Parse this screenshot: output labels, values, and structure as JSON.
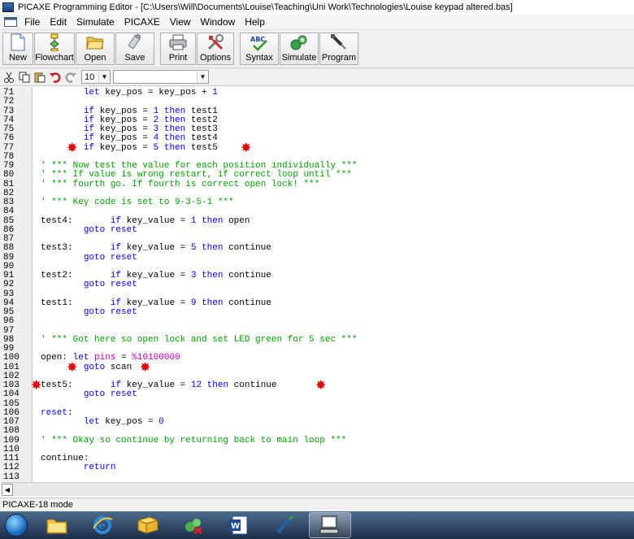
{
  "window": {
    "title": "PICAXE Programming Editor - [C:\\Users\\Will\\Documents\\Louise\\Teaching\\Uni Work\\Technologies\\Louise keypad altered.bas]"
  },
  "menu": [
    "File",
    "Edit",
    "Simulate",
    "PICAXE",
    "View",
    "Window",
    "Help"
  ],
  "toolbar": {
    "new": "New",
    "flowchart": "Flowchart",
    "open": "Open",
    "save": "Save",
    "print": "Print",
    "options": "Options",
    "syntax": "Syntax",
    "simulate": "Simulate",
    "program": "Program"
  },
  "toolbar2": {
    "font_size": "10",
    "combo_value": ""
  },
  "editor": {
    "lines": [
      {
        "n": "71",
        "t": [
          [
            "        ",
            ""
          ],
          [
            "let",
            "kw"
          ],
          [
            " key_pos = key_pos + ",
            ""
          ],
          [
            "1",
            "kw"
          ]
        ]
      },
      {
        "n": "72",
        "t": []
      },
      {
        "n": "73",
        "t": [
          [
            "        ",
            ""
          ],
          [
            "if",
            "kw"
          ],
          [
            " key_pos = ",
            ""
          ],
          [
            "1",
            "kw"
          ],
          [
            " ",
            ""
          ],
          [
            "then",
            "kw"
          ],
          [
            " test1",
            ""
          ]
        ]
      },
      {
        "n": "74",
        "t": [
          [
            "        ",
            ""
          ],
          [
            "if",
            "kw"
          ],
          [
            " key_pos = ",
            ""
          ],
          [
            "2",
            "kw"
          ],
          [
            " ",
            ""
          ],
          [
            "then",
            "kw"
          ],
          [
            " test2",
            ""
          ]
        ]
      },
      {
        "n": "75",
        "t": [
          [
            "        ",
            ""
          ],
          [
            "if",
            "kw"
          ],
          [
            " key_pos = ",
            ""
          ],
          [
            "3",
            "kw"
          ],
          [
            " ",
            ""
          ],
          [
            "then",
            "kw"
          ],
          [
            " test3",
            ""
          ]
        ]
      },
      {
        "n": "76",
        "t": [
          [
            "        ",
            ""
          ],
          [
            "if",
            "kw"
          ],
          [
            " key_pos = ",
            ""
          ],
          [
            "4",
            "kw"
          ],
          [
            " ",
            ""
          ],
          [
            "then",
            "kw"
          ],
          [
            " test4",
            ""
          ]
        ]
      },
      {
        "n": "77",
        "t": [
          [
            "        ",
            ""
          ],
          [
            "if",
            "kw"
          ],
          [
            " key_pos = ",
            ""
          ],
          [
            "5",
            "kw"
          ],
          [
            " ",
            ""
          ],
          [
            "then",
            "kw"
          ],
          [
            " test5",
            ""
          ]
        ]
      },
      {
        "n": "78",
        "t": []
      },
      {
        "n": "79",
        "t": [
          [
            "' *** Now test the value for each position individually ***",
            "cm"
          ]
        ]
      },
      {
        "n": "80",
        "t": [
          [
            "' *** If value is wrong restart, if correct loop until ***",
            "cm"
          ]
        ]
      },
      {
        "n": "81",
        "t": [
          [
            "' *** fourth go. If fourth is correct open lock! ***",
            "cm"
          ]
        ]
      },
      {
        "n": "82",
        "t": []
      },
      {
        "n": "83",
        "t": [
          [
            "' *** Key code is set to 9-3-5-1 ***",
            "cm"
          ]
        ]
      },
      {
        "n": "84",
        "t": []
      },
      {
        "n": "85",
        "t": [
          [
            "test4:",
            ""
          ],
          [
            "       ",
            ""
          ],
          [
            "if",
            "kw"
          ],
          [
            " key_value = ",
            ""
          ],
          [
            "1",
            "kw"
          ],
          [
            " ",
            ""
          ],
          [
            "then",
            "kw"
          ],
          [
            " open",
            ""
          ]
        ]
      },
      {
        "n": "86",
        "t": [
          [
            "        ",
            ""
          ],
          [
            "goto",
            "kw"
          ],
          [
            " ",
            ""
          ],
          [
            "reset",
            "kw"
          ]
        ]
      },
      {
        "n": "87",
        "t": []
      },
      {
        "n": "88",
        "t": [
          [
            "test3:",
            ""
          ],
          [
            "       ",
            ""
          ],
          [
            "if",
            "kw"
          ],
          [
            " key_value = ",
            ""
          ],
          [
            "5",
            "kw"
          ],
          [
            " ",
            ""
          ],
          [
            "then",
            "kw"
          ],
          [
            " continue",
            ""
          ]
        ]
      },
      {
        "n": "89",
        "t": [
          [
            "        ",
            ""
          ],
          [
            "goto",
            "kw"
          ],
          [
            " ",
            ""
          ],
          [
            "reset",
            "kw"
          ]
        ]
      },
      {
        "n": "90",
        "t": []
      },
      {
        "n": "91",
        "t": [
          [
            "test2:",
            ""
          ],
          [
            "       ",
            ""
          ],
          [
            "if",
            "kw"
          ],
          [
            " key_value = ",
            ""
          ],
          [
            "3",
            "kw"
          ],
          [
            " ",
            ""
          ],
          [
            "then",
            "kw"
          ],
          [
            " continue",
            ""
          ]
        ]
      },
      {
        "n": "92",
        "t": [
          [
            "        ",
            ""
          ],
          [
            "goto",
            "kw"
          ],
          [
            " ",
            ""
          ],
          [
            "reset",
            "kw"
          ]
        ]
      },
      {
        "n": "93",
        "t": []
      },
      {
        "n": "94",
        "t": [
          [
            "test1:",
            ""
          ],
          [
            "       ",
            ""
          ],
          [
            "if",
            "kw"
          ],
          [
            " key_value = ",
            ""
          ],
          [
            "9",
            "kw"
          ],
          [
            " ",
            ""
          ],
          [
            "then",
            "kw"
          ],
          [
            " continue",
            ""
          ]
        ]
      },
      {
        "n": "95",
        "t": [
          [
            "        ",
            ""
          ],
          [
            "goto",
            "kw"
          ],
          [
            " ",
            ""
          ],
          [
            "reset",
            "kw"
          ]
        ]
      },
      {
        "n": "96",
        "t": []
      },
      {
        "n": "97",
        "t": []
      },
      {
        "n": "98",
        "t": [
          [
            "' *** Got here so open lock and set LED green for 5 sec ***",
            "cm"
          ]
        ]
      },
      {
        "n": "99",
        "t": []
      },
      {
        "n": "100",
        "t": [
          [
            "open",
            ""
          ],
          [
            ":",
            "kw"
          ],
          [
            " ",
            ""
          ],
          [
            "let",
            "kw"
          ],
          [
            " ",
            ""
          ],
          [
            "pins",
            "pins"
          ],
          [
            " = ",
            ""
          ],
          [
            "%10100000",
            "pins"
          ]
        ]
      },
      {
        "n": "101",
        "t": [
          [
            "        ",
            ""
          ],
          [
            "goto",
            "kw"
          ],
          [
            " scan",
            ""
          ]
        ]
      },
      {
        "n": "102",
        "t": []
      },
      {
        "n": "103",
        "t": [
          [
            "test5:",
            ""
          ],
          [
            "       ",
            ""
          ],
          [
            "if",
            "kw"
          ],
          [
            " key_value = ",
            ""
          ],
          [
            "12",
            "kw"
          ],
          [
            " ",
            ""
          ],
          [
            "then",
            "kw"
          ],
          [
            " continue",
            ""
          ]
        ]
      },
      {
        "n": "104",
        "t": [
          [
            "        ",
            ""
          ],
          [
            "goto",
            "kw"
          ],
          [
            " ",
            ""
          ],
          [
            "reset",
            "kw"
          ]
        ]
      },
      {
        "n": "105",
        "t": []
      },
      {
        "n": "106",
        "t": [
          [
            "reset",
            "kw"
          ],
          [
            ":",
            ""
          ]
        ]
      },
      {
        "n": "107",
        "t": [
          [
            "        ",
            ""
          ],
          [
            "let",
            "kw"
          ],
          [
            " key_pos = ",
            ""
          ],
          [
            "0",
            "kw"
          ]
        ]
      },
      {
        "n": "108",
        "t": []
      },
      {
        "n": "109",
        "t": [
          [
            "' *** Okay so continue by returning back to main loop ***",
            "cm"
          ]
        ]
      },
      {
        "n": "110",
        "t": []
      },
      {
        "n": "111",
        "t": [
          [
            "continue",
            ""
          ],
          [
            ":",
            "kw"
          ]
        ]
      },
      {
        "n": "112",
        "t": [
          [
            "        ",
            ""
          ],
          [
            "return",
            "kw"
          ]
        ]
      },
      {
        "n": "113",
        "t": []
      }
    ],
    "annotation_marker": "✸"
  },
  "status": {
    "mode": "PICAXE-18 mode"
  },
  "colors": {
    "keyword": "#0000ff",
    "comment": "#00a000",
    "pins": "#c000c0",
    "annotation": "#e00000"
  },
  "taskbar": {
    "items": [
      "windows-explorer-icon",
      "internet-explorer-icon",
      "folder-icon",
      "network-icon",
      "word-icon",
      "picaxe-icon",
      "computer-icon"
    ]
  }
}
